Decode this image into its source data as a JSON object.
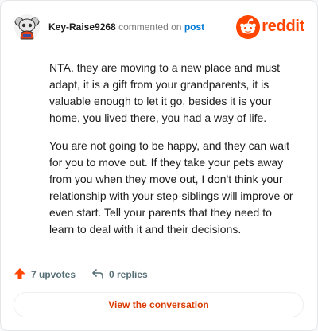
{
  "header": {
    "username": "Key-Raise9268",
    "verb": "commented on",
    "post_link": "post",
    "brand": "reddit",
    "avatar_icon": "snoo-avatar-icon",
    "logo_icon": "reddit-logo-icon",
    "brand_color": "#ff4500"
  },
  "comment": {
    "paragraphs": [
      "NTA. they are moving to a new place and must adapt, it is a gift from your grandparents, it is valuable enough to let it go, besides it is your home, you lived there, you had a way of life.",
      "You are not going to be happy, and they can wait for you to move out. If they take your pets away from you when they move out, I don't think your relationship with your step-siblings will improve or even start. Tell your parents that they need to learn to deal with it and their decisions."
    ]
  },
  "actions": {
    "upvotes": "7 upvotes",
    "replies": "0 replies",
    "upvote_icon": "upvote-arrow-icon",
    "reply_icon": "reply-arrow-icon",
    "upvote_color": "#ff4500"
  },
  "cta": {
    "label": "View the conversation",
    "color": "#d93a00"
  }
}
